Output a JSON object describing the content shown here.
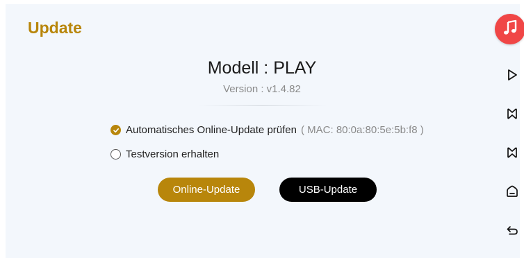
{
  "header": {
    "title": "Update"
  },
  "device": {
    "model": "Modell : PLAY",
    "version": "Version : v1.4.82"
  },
  "options": [
    {
      "label": "Automatisches Online-Update prüfen",
      "mac": "( MAC: 80:0a:80:5e:5b:f8 )",
      "checked": true
    },
    {
      "label": "Testversion erhalten",
      "checked": false
    }
  ],
  "buttons": {
    "online_update": "Online-Update",
    "usb_update": "USB-Update"
  },
  "sidebar": {
    "icons": [
      "music-note-icon",
      "play-icon",
      "previous-track-icon",
      "next-track-icon",
      "home-icon",
      "back-icon"
    ]
  },
  "colors": {
    "accent": "#b8860b",
    "music_badge": "#f04646",
    "background": "#f3f7fc"
  }
}
